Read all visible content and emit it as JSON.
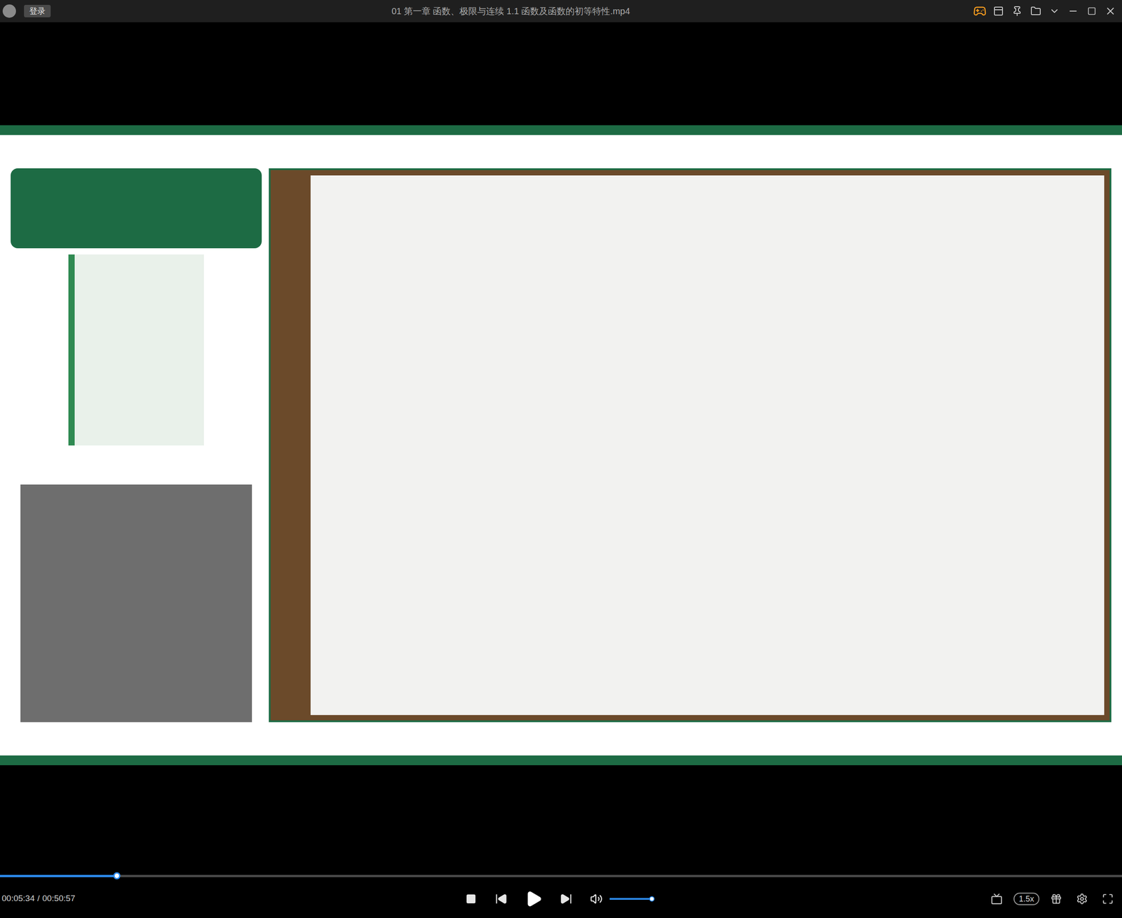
{
  "window": {
    "title": "01 第一章 函数、极限与连续 1.1 函数及函数的初等特性.mp4",
    "login_button": "登录"
  },
  "player": {
    "playing": false,
    "current_time": "00:05:34",
    "separator": "/",
    "total_time": "00:50:57",
    "progress": {
      "level": 0.104
    },
    "volume": {
      "level": 1.0
    },
    "speed": "1.5x"
  }
}
